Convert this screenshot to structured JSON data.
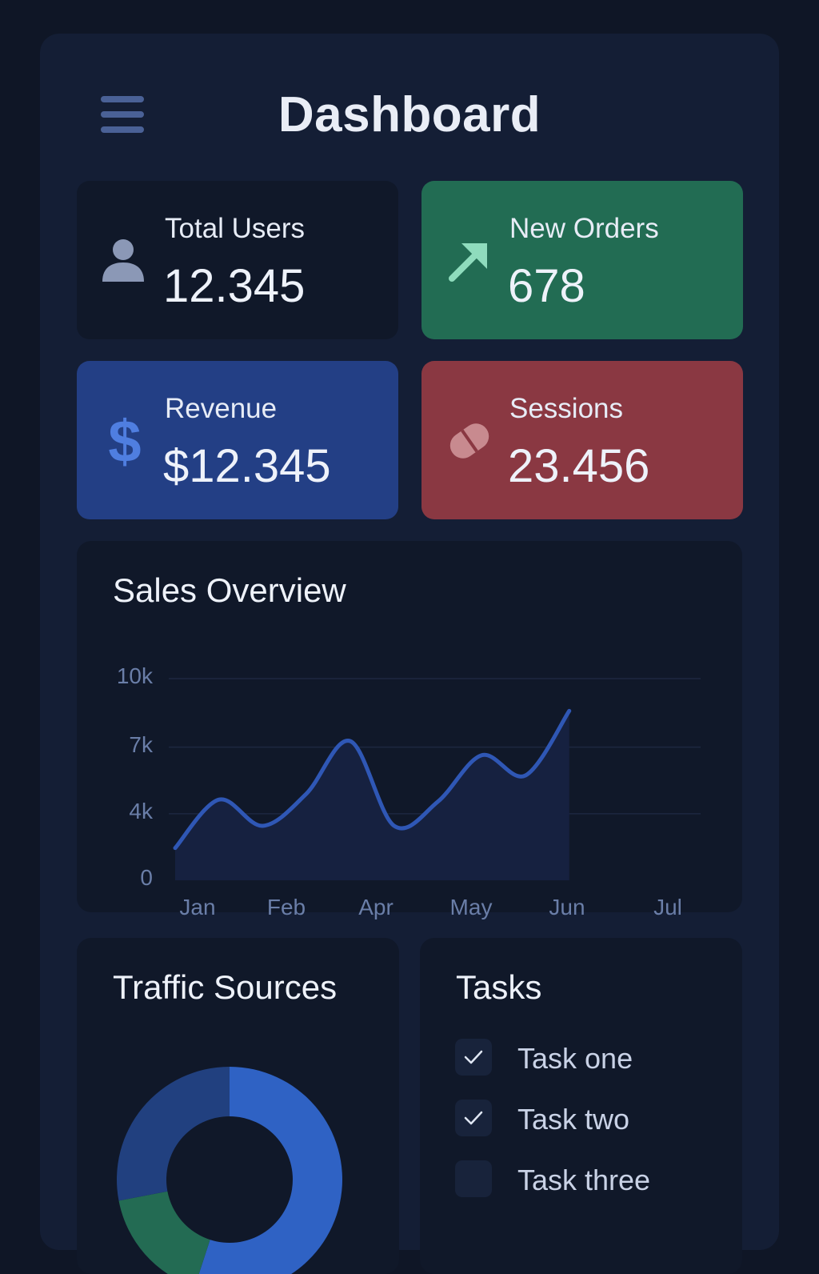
{
  "header": {
    "title": "Dashboard",
    "menu_icon": "hamburger-menu-icon"
  },
  "stats": [
    {
      "label": "Total Users",
      "value": "12.345",
      "icon": "user-icon",
      "color": "#101829"
    },
    {
      "label": "New Orders",
      "value": "678",
      "icon": "arrow-up-right-icon",
      "color": "#226c53"
    },
    {
      "label": "Revenue",
      "value": "$12.345",
      "icon": "dollar-icon",
      "color": "#233f85"
    },
    {
      "label": "Sessions",
      "value": "23.456",
      "icon": "pill-icon",
      "color": "#8a3842"
    }
  ],
  "sales": {
    "title": "Sales Overview",
    "chart_data": {
      "type": "area",
      "title": "Sales Overview",
      "xlabel": "",
      "ylabel": "",
      "y_ticks": [
        "10k",
        "7k",
        "4k",
        "0"
      ],
      "x_ticks": [
        "Jan",
        "Feb",
        "Apr",
        "May",
        "Jun",
        "Jul"
      ],
      "ylim": [
        0,
        10000
      ],
      "grid": true,
      "line_color": "#2f57b5",
      "x": [
        0,
        0.5,
        1,
        1.5,
        2,
        2.5,
        3,
        3.5,
        4,
        4.5,
        5,
        5.5,
        6
      ],
      "values": [
        1600,
        4000,
        2700,
        4300,
        6900,
        2700,
        3900,
        6200,
        5200,
        8400
      ]
    }
  },
  "traffic": {
    "title": "Traffic Sources",
    "chart_data": {
      "type": "pie",
      "title": "Traffic Sources",
      "slices": [
        {
          "value": 55,
          "color": "#2f62c4"
        },
        {
          "value": 17,
          "color": "#236b53"
        },
        {
          "value": 28,
          "color": "#21407f"
        }
      ]
    }
  },
  "tasks": {
    "title": "Tasks",
    "items": [
      {
        "label": "Task one",
        "checked": true
      },
      {
        "label": "Task two",
        "checked": true
      },
      {
        "label": "Task three",
        "checked": false
      }
    ]
  }
}
